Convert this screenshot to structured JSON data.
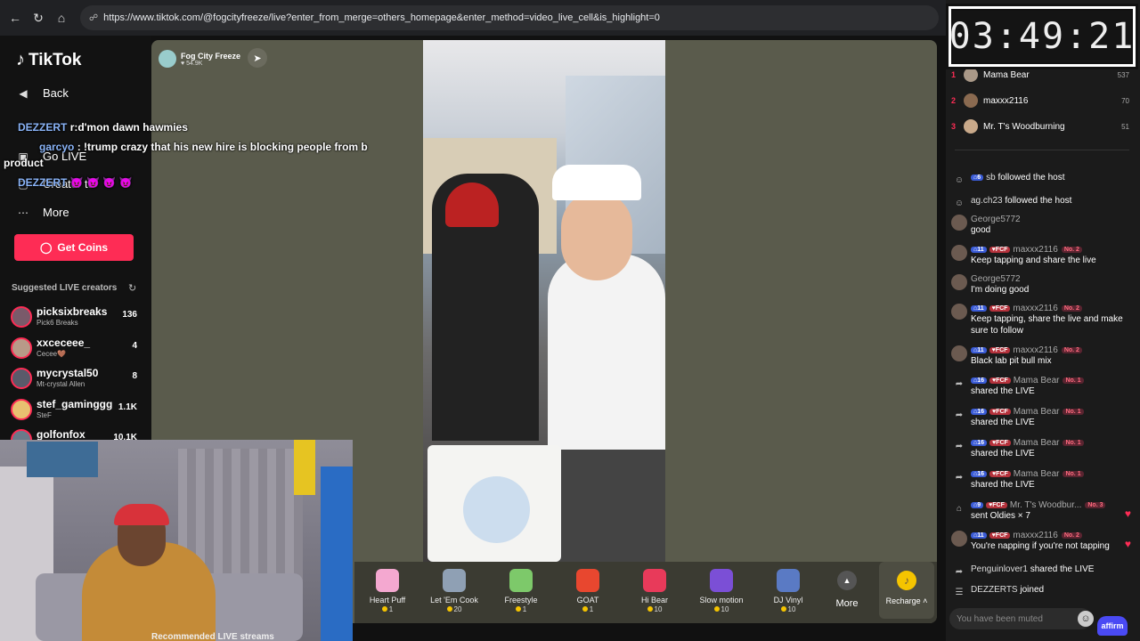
{
  "browser": {
    "url": "https://www.tiktok.com/@fogcityfreeze/live?enter_from_merge=others_homepage&enter_method=video_live_cell&is_highlight=0"
  },
  "sidebar": {
    "logo": "TikTok",
    "back": "Back",
    "go_live": "Go LIVE",
    "creator_tools": "Creator to",
    "more": "More",
    "get_coins": "Get Coins",
    "suggested_title": "Suggested LIVE creators",
    "creators": [
      {
        "name": "picksixbreaks",
        "sub": "Pick6 Breaks",
        "count": "136"
      },
      {
        "name": "xxceceee_",
        "sub": "Cecee🤎",
        "count": "4"
      },
      {
        "name": "mycrystal50",
        "sub": "Mt-crystal Allen",
        "count": "8"
      },
      {
        "name": "stef_gaminggg",
        "sub": "SteF",
        "count": "1.1K"
      },
      {
        "name": "golfonfox",
        "sub": "",
        "count": "10.1K"
      }
    ]
  },
  "overlay_chat": [
    {
      "user": "DEZZERT",
      "text": "r:d'mon dawn hawmies"
    },
    {
      "user": "garcyo",
      "text": ": !trump crazy that his new hire is blocking people from b"
    },
    {
      "user": "",
      "text": "product"
    },
    {
      "user": "DEZZERT",
      "text": "😈 😈 😈 😈"
    }
  ],
  "stream": {
    "host_name": "Fog City Freeze",
    "host_likes": "54.9K"
  },
  "gifts": [
    {
      "name": "Heart Puff",
      "price": "1",
      "color": "#f4a8d0"
    },
    {
      "name": "Let 'Em Cook",
      "price": "20",
      "color": "#8fa0b4"
    },
    {
      "name": "Freestyle",
      "price": "1",
      "color": "#7dc96a"
    },
    {
      "name": "GOAT",
      "price": "1",
      "color": "#e8472f"
    },
    {
      "name": "Hi Bear",
      "price": "10",
      "color": "#e83a5a"
    },
    {
      "name": "Slow motion",
      "price": "10",
      "color": "#7b4fd6"
    },
    {
      "name": "DJ Vinyl",
      "price": "10",
      "color": "#5a7ac4"
    }
  ],
  "gift_more": "More",
  "recharge": "Recharge",
  "webcam_caption": "Recommended LIVE streams",
  "timer": "03:49:21",
  "viewers": [
    {
      "rank": "1",
      "name": "Mama Bear",
      "score": "537"
    },
    {
      "rank": "2",
      "name": "maxxx2116",
      "score": "70"
    },
    {
      "rank": "3",
      "name": "Mr. T's Woodburning",
      "score": "51"
    }
  ],
  "messages": [
    {
      "user": "sb",
      "text": "followed the host",
      "lv": "6"
    },
    {
      "user": "ag.ch23",
      "text": "followed the host"
    },
    {
      "user": "George5772",
      "text": "good"
    },
    {
      "user": "maxxx2116",
      "text": "Keep tapping and share the live",
      "lv": "11",
      "no": "No. 2"
    },
    {
      "user": "George5772",
      "text": "I'm doing good"
    },
    {
      "user": "maxxx2116",
      "text": "Keep tapping, share the live and make sure to follow",
      "lv": "11",
      "no": "No. 2"
    },
    {
      "user": "maxxx2116",
      "text": "Black lab pit bull mix",
      "lv": "11",
      "no": "No. 2"
    },
    {
      "user": "Mama Bear",
      "text": "shared the LIVE",
      "lv": "16",
      "no": "No. 1"
    },
    {
      "user": "Mama Bear",
      "text": "shared the LIVE",
      "lv": "16",
      "no": "No. 1"
    },
    {
      "user": "Mama Bear",
      "text": "shared the LIVE",
      "lv": "16",
      "no": "No. 1"
    },
    {
      "user": "Mama Bear",
      "text": "shared the LIVE",
      "lv": "16",
      "no": "No. 1"
    },
    {
      "user": "Mr. T's Woodbur...",
      "text": "sent Oldies × 7",
      "lv": "9",
      "no": "No. 3"
    },
    {
      "user": "maxxx2116",
      "text": "You're napping if you're not tapping",
      "lv": "11",
      "no": "No. 2"
    },
    {
      "user": "Penguinlover1",
      "text": "shared the LIVE"
    },
    {
      "user": "DEZZERTS",
      "text": "joined"
    }
  ],
  "chat_input_placeholder": "You have been muted",
  "affirm": "affirm",
  "badge_fcf": "FCF"
}
